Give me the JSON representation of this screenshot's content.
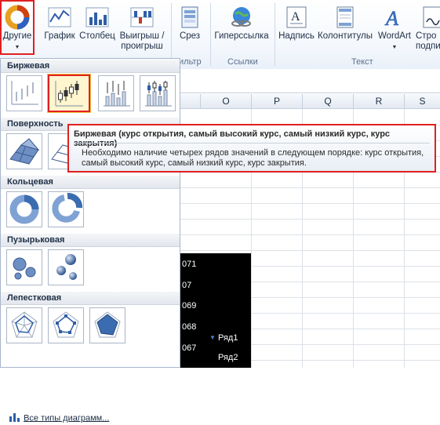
{
  "ribbon": {
    "buttons": [
      {
        "label": "Другие",
        "icon": "other-charts-icon"
      },
      {
        "label": "График",
        "icon": "line-chart-icon"
      },
      {
        "label": "Столбец",
        "icon": "column-chart-icon"
      },
      {
        "label": "Выигрыш /",
        "label2": "проигрыш",
        "icon": "win-loss-icon"
      },
      {
        "label": "Срез",
        "icon": "slicer-icon"
      },
      {
        "label": "Гиперссылка",
        "icon": "hyperlink-icon"
      },
      {
        "label": "Надпись",
        "icon": "textbox-icon"
      },
      {
        "label": "Колонтитулы",
        "icon": "header-footer-icon"
      },
      {
        "label": "WordArt",
        "icon": "wordart-icon"
      },
      {
        "label": "Стро",
        "label2": "подпи",
        "icon": "signature-line-icon"
      }
    ],
    "groups": {
      "filter": "ильтр",
      "links": "Ссылки",
      "text": "Текст"
    }
  },
  "sheet": {
    "columns": [
      "O",
      "P",
      "Q",
      "R",
      "S"
    ],
    "chart_axis": [
      "071",
      "07",
      "069",
      "068",
      "067"
    ],
    "legend": [
      "Ряд1",
      "Ряд2"
    ]
  },
  "gallery": {
    "sections": [
      "Биржевая",
      "Поверхность",
      "Кольцевая",
      "Пузырьковая",
      "Лепестковая"
    ],
    "all_charts": "Все типы диаграмм..."
  },
  "tooltip": {
    "title": "Биржевая (курс открытия, самый высокий курс, самый низкий курс, курс закрытия)",
    "body": "Необходимо наличие четырех рядов значений в следующем порядке: курс открытия, самый высокий курс, самый низкий курс, курс закрытия."
  },
  "colors": {
    "highlight": "#e02020",
    "selected_fill": "#fff6cf",
    "chart_bg": "#000000"
  }
}
